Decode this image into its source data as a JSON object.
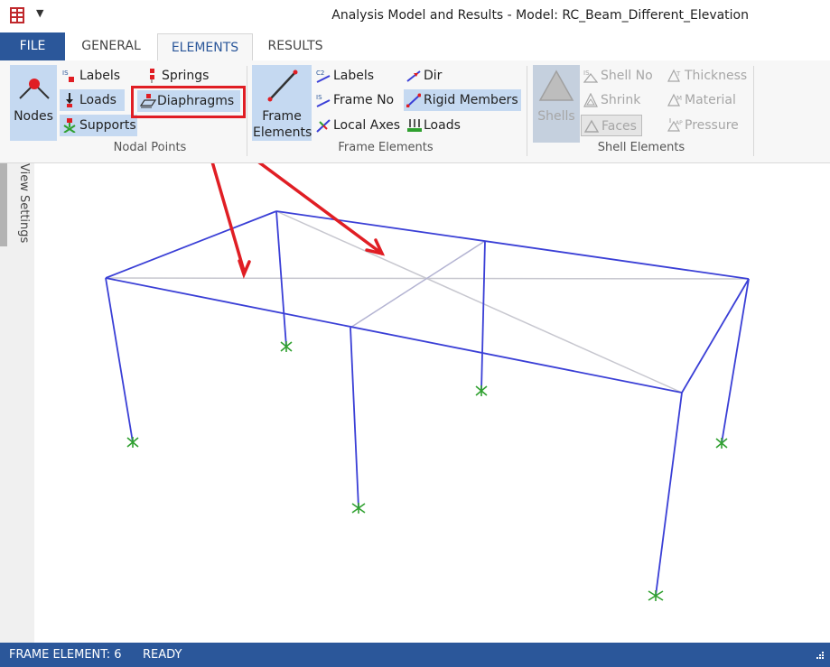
{
  "window": {
    "title": "Analysis Model and Results - Model: RC_Beam_Different_Elevation"
  },
  "tabs": [
    {
      "label": "FILE"
    },
    {
      "label": "GENERAL"
    },
    {
      "label": "ELEMENTS"
    },
    {
      "label": "RESULTS"
    }
  ],
  "ribbon": {
    "nodal_points": {
      "group_label": "Nodal Points",
      "nodes_label": "Nodes",
      "labels": "Labels",
      "loads": "Loads",
      "supports": "Supports",
      "springs": "Springs",
      "diaphragms": "Diaphragms"
    },
    "frame_elements": {
      "group_label": "Frame Elements",
      "big_label_line1": "Frame",
      "big_label_line2": "Elements",
      "labels": "Labels",
      "frame_no": "Frame No",
      "local_axes": "Local Axes",
      "dir": "Dir",
      "rigid_members": "Rigid Members",
      "loads": "Loads"
    },
    "shell_elements": {
      "group_label": "Shell Elements",
      "shells": "Shells",
      "shell_no": "Shell  No",
      "shrink": "Shrink",
      "faces": "Faces",
      "thickness": "Thickness",
      "material": "Material",
      "pressure": "Pressure"
    }
  },
  "side_panel": {
    "label": "View Settings"
  },
  "status": {
    "element": "FRAME ELEMENT: 6",
    "state": "READY"
  },
  "colors": {
    "accent": "#2b579a",
    "frame": "#3a3fd6",
    "support": "#2fa02f",
    "highlight": "#e01e24",
    "rigid": "#b9b9c8"
  }
}
